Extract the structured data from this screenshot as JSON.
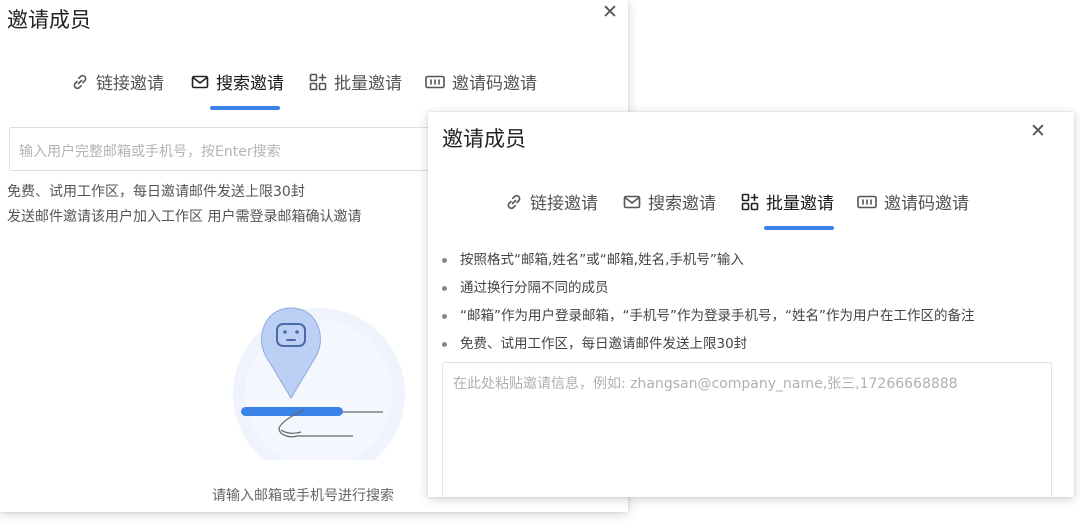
{
  "dialog_search": {
    "title": "邀请成员",
    "close": "✕",
    "tabs": [
      "链接邀请",
      "搜索邀请",
      "批量邀请",
      "邀请码邀请"
    ],
    "active_tab": 1,
    "search_placeholder": "输入用户完整邮箱或手机号，按Enter搜索",
    "hint_lines": [
      "免费、试用工作区，每日邀请邮件发送上限30封",
      "发送邮件邀请该用户加入工作区 用户需登录邮箱确认邀请"
    ],
    "empty_text": "请输入邮箱或手机号进行搜索"
  },
  "dialog_batch": {
    "title": "邀请成员",
    "close": "✕",
    "tabs": [
      "链接邀请",
      "搜索邀请",
      "批量邀请",
      "邀请码邀请"
    ],
    "active_tab": 2,
    "bullets": [
      "按照格式“邮箱,姓名”或“邮箱,姓名,手机号”输入",
      "通过换行分隔不同的成员",
      "“邮箱”作为用户登录邮箱，“手机号”作为登录手机号，“姓名”作为用户在工作区的备注",
      "免费、试用工作区，每日邀请邮件发送上限30封"
    ],
    "textarea_placeholder": "在此处粘贴邀请信息，例如: zhangsan@company_name,张三,17266668888"
  },
  "icons": {
    "tab_icons": [
      "link-icon",
      "mail-icon",
      "grid-add-icon",
      "code-icon"
    ],
    "accent": "#3b82e6"
  }
}
